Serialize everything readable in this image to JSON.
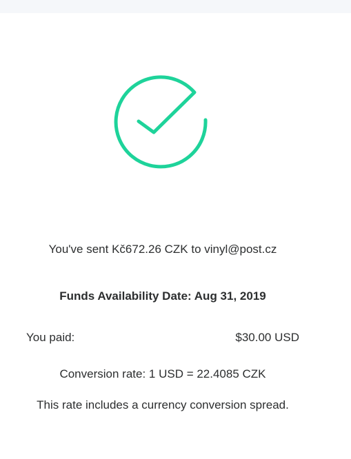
{
  "icon": {
    "name": "checkmark-circle-icon",
    "color": "#1ed39a"
  },
  "confirmation": {
    "sent_message": "You've sent Kč672.26 CZK to vinyl@post.cz",
    "funds_availability": "Funds Availability Date: Aug 31, 2019"
  },
  "payment": {
    "paid_label": "You paid:",
    "paid_amount": "$30.00 USD",
    "conversion_rate": "Conversion rate: 1 USD = 22.4085 CZK",
    "rate_note": "This rate includes a currency conversion spread."
  }
}
